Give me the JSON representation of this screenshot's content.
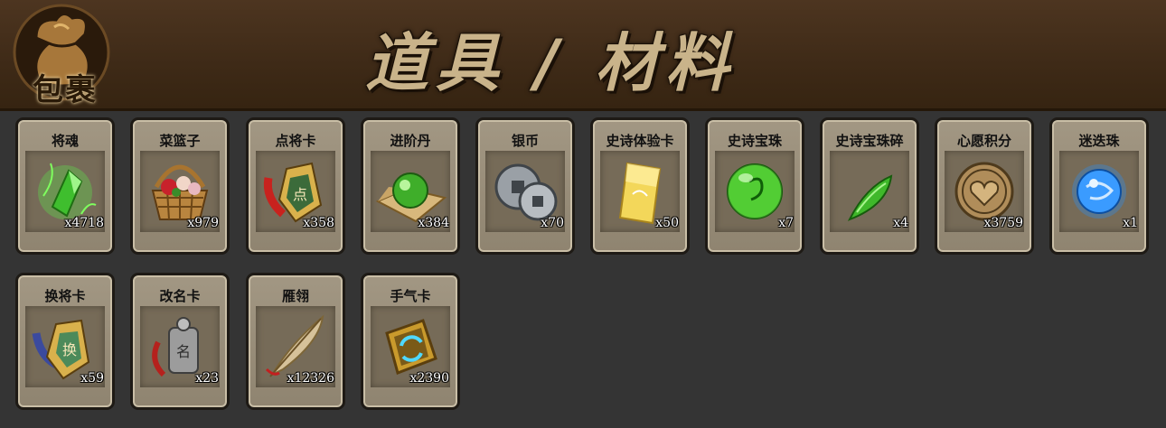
{
  "header": {
    "bag_label": "包裹",
    "title": "道具 / 材料"
  },
  "items": [
    {
      "name": "将魂",
      "qty": "x4718",
      "icon": "green-crystal-icon"
    },
    {
      "name": "菜篮子",
      "qty": "x979",
      "icon": "flower-basket-icon"
    },
    {
      "name": "点将卡",
      "qty": "x358",
      "icon": "general-card-icon"
    },
    {
      "name": "进阶丹",
      "qty": "x384",
      "icon": "green-pill-icon"
    },
    {
      "name": "银币",
      "qty": "x70",
      "icon": "silver-coin-icon"
    },
    {
      "name": "史诗体验卡",
      "qty": "x50",
      "icon": "gold-card-icon"
    },
    {
      "name": "史诗宝珠",
      "qty": "x7",
      "icon": "green-orb-icon"
    },
    {
      "name": "史诗宝珠碎",
      "qty": "x4",
      "icon": "green-shard-icon"
    },
    {
      "name": "心愿积分",
      "qty": "x3759",
      "icon": "heart-coin-icon"
    },
    {
      "name": "迷迭珠",
      "qty": "x1",
      "icon": "blue-orb-icon"
    },
    {
      "name": "换将卡",
      "qty": "x59",
      "icon": "swap-card-icon"
    },
    {
      "name": "改名卡",
      "qty": "x23",
      "icon": "rename-card-icon"
    },
    {
      "name": "雁翎",
      "qty": "x12326",
      "icon": "feather-icon"
    },
    {
      "name": "手气卡",
      "qty": "x2390",
      "icon": "luck-card-icon"
    }
  ]
}
